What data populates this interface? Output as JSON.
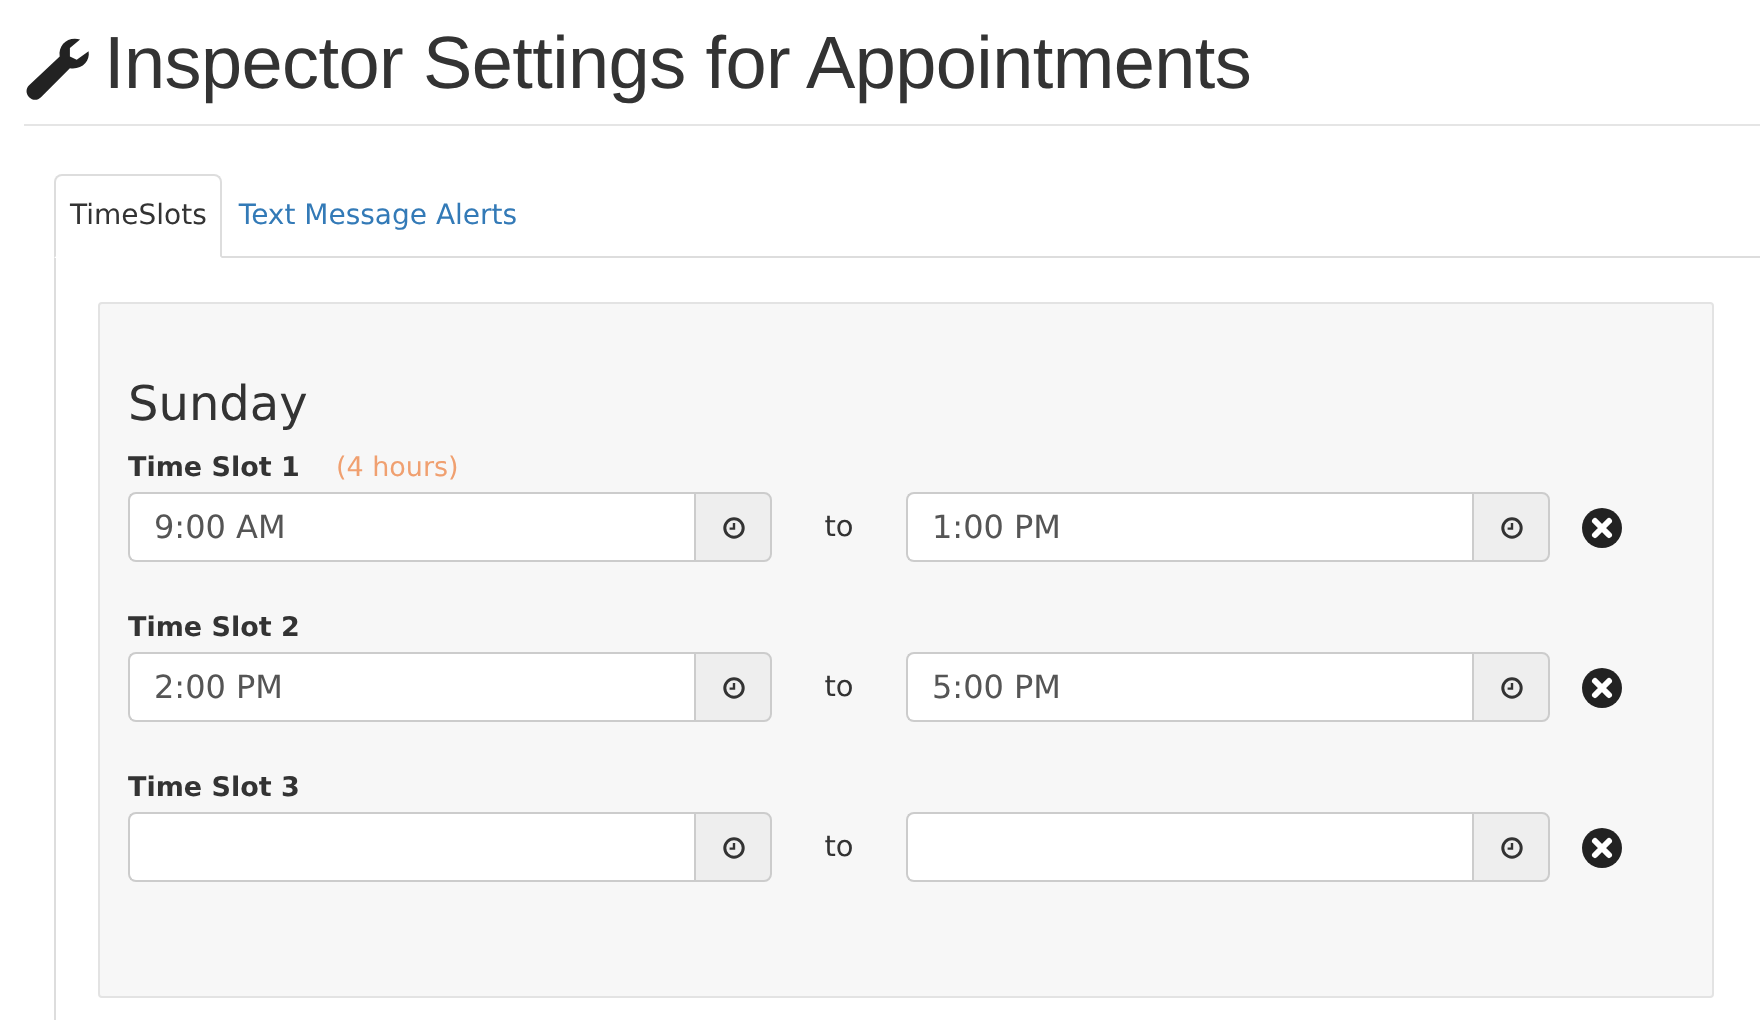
{
  "title": "Inspector Settings for Appointments",
  "tabs": [
    {
      "label": "TimeSlots",
      "selected": true
    },
    {
      "label": "Text Message Alerts",
      "selected": false
    }
  ],
  "day": "Sunday",
  "slots": [
    {
      "label": "Time Slot 1",
      "duration": "(4 hours)",
      "start": "9:00 AM",
      "separator": "to",
      "end": "1:00 PM"
    },
    {
      "label": "Time Slot 2",
      "start": "2:00 PM",
      "separator": "to",
      "end": "5:00 PM"
    },
    {
      "label": "Time Slot 3",
      "separator": "to"
    }
  ]
}
